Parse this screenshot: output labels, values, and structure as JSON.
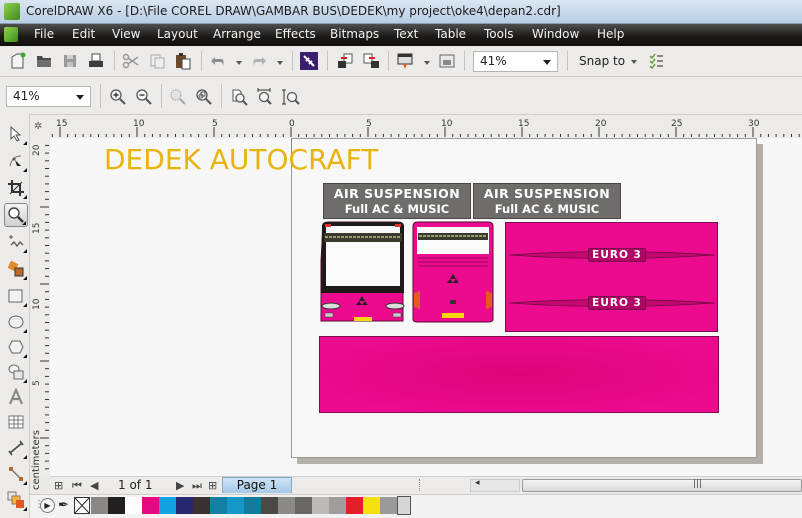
{
  "window": {
    "title": "CorelDRAW X6 - [D:\\File COREL DRAW\\GAMBAR BUS\\DEDEK\\my project\\oke4\\depan2.cdr]"
  },
  "menu": {
    "items": [
      {
        "label": "File"
      },
      {
        "label": "Edit"
      },
      {
        "label": "View"
      },
      {
        "label": "Layout"
      },
      {
        "label": "Arrange"
      },
      {
        "label": "Effects"
      },
      {
        "label": "Bitmaps"
      },
      {
        "label": "Text"
      },
      {
        "label": "Table"
      },
      {
        "label": "Tools"
      },
      {
        "label": "Window"
      },
      {
        "label": "Help"
      }
    ]
  },
  "standard_toolbar": {
    "zoom_level": "41%",
    "snap_to_label": "Snap to",
    "icons": [
      "new-document-icon",
      "open-icon",
      "save-icon",
      "print-icon",
      "cut-icon",
      "copy-icon",
      "paste-icon",
      "undo-icon",
      "redo-icon",
      "search-content-icon",
      "import-icon",
      "export-icon",
      "publish-pdf-icon",
      "application-launcher-icon",
      "snap-options-icon"
    ]
  },
  "zoom_toolbar": {
    "zoom_level": "41%",
    "icons": [
      "zoom-in-icon",
      "zoom-out-icon",
      "zoom-selected-icon",
      "zoom-all-objects-icon",
      "zoom-page-icon",
      "zoom-page-width-icon",
      "zoom-page-height-icon"
    ]
  },
  "rulers": {
    "horizontal_labels": [
      "15",
      "10",
      "5",
      "0",
      "5",
      "10",
      "15",
      "20",
      "25",
      "30"
    ],
    "vertical_labels": [
      "20",
      "15",
      "10",
      "5"
    ],
    "unit": "centimeters"
  },
  "toolbox": {
    "tools": [
      {
        "name": "pick-tool"
      },
      {
        "name": "shape-tool"
      },
      {
        "name": "crop-tool"
      },
      {
        "name": "zoom-tool",
        "active": true
      },
      {
        "name": "freehand-tool"
      },
      {
        "name": "smart-fill-tool"
      },
      {
        "name": "rectangle-tool"
      },
      {
        "name": "ellipse-tool"
      },
      {
        "name": "polygon-tool"
      },
      {
        "name": "basic-shapes-tool"
      },
      {
        "name": "text-tool"
      },
      {
        "name": "table-tool"
      },
      {
        "name": "dimension-tool"
      },
      {
        "name": "connector-tool"
      },
      {
        "name": "interactive-fill-tool"
      }
    ]
  },
  "document": {
    "brand_text": "DEDEK AUTOCRAFT",
    "badges": [
      {
        "line1": "AIR SUSPENSION",
        "line2": "Full AC & MUSIC"
      },
      {
        "line1": "AIR SUSPENSION",
        "line2": "Full AC & MUSIC"
      }
    ],
    "euro_labels": [
      "EURO 3",
      "EURO 3"
    ],
    "colors": {
      "brand_text": "#e8b40c",
      "magenta": "#ec0a8e",
      "badge_gray": "#706c6c"
    }
  },
  "page_navigator": {
    "page_count": "1 of 1",
    "page_tab": "Page 1"
  },
  "palette": {
    "colors": [
      "#8a8787",
      "#231f1e",
      "#ffffff",
      "#e4097f",
      "#10a4e3",
      "#27286f",
      "#3a3231",
      "#127fa5",
      "#1598c8",
      "#137a9b",
      "#4c4846",
      "#8c8987",
      "#6a6665",
      "#bdbbba",
      "#a09d9c",
      "#e21f26",
      "#f5df0c",
      "#9c9a99"
    ]
  }
}
